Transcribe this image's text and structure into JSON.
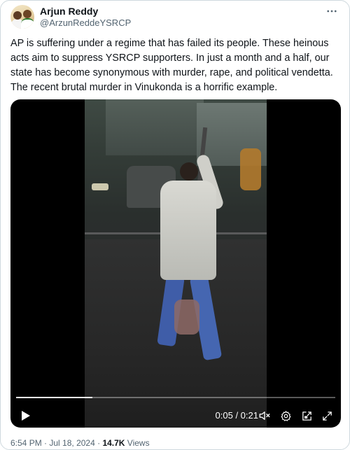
{
  "author": {
    "name": "Arjun Reddy",
    "handle": "@ArzunReddeYSRCP"
  },
  "more_icon": "more-horizontal-icon",
  "tweet_text": "AP is suffering under a regime that has failed its people. These heinous acts aim to suppress YSRCP supporters. In just a month and a half, our state has become synonymous with murder, rape, and political vendetta. The recent brutal murder in Vinukonda is a horrific example.",
  "video": {
    "progress_fraction": 0.238,
    "time_display": "0:05 / 0:21",
    "controls": {
      "play": "play-icon",
      "mute": "volume-muted-icon",
      "settings": "gear-icon",
      "popout": "picture-in-picture-icon",
      "fullscreen": "fullscreen-icon"
    }
  },
  "meta": {
    "time": "6:54 PM",
    "sep1": " · ",
    "date": "Jul 18, 2024",
    "sep2": " · ",
    "views_count": "14.7K",
    "views_label": " Views"
  },
  "colors": {
    "text": "#0f1419",
    "secondary": "#536471",
    "border": "#cfd9de"
  }
}
